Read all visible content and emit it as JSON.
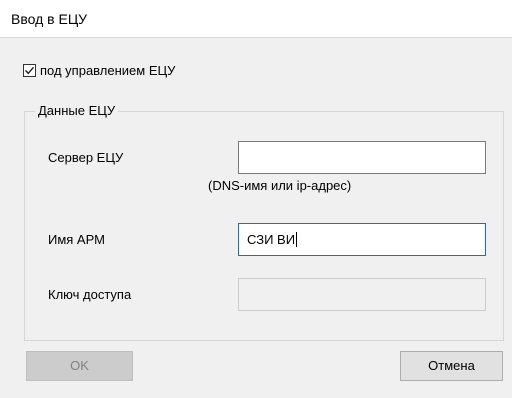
{
  "window": {
    "title": "Ввод в ЕЦУ"
  },
  "managed": {
    "label": "под управлением ЕЦУ",
    "checked": true
  },
  "group": {
    "title": "Данные ЕЦУ",
    "server_label": "Сервер ЕЦУ",
    "server_value": "",
    "server_hint": "(DNS-имя или ip-адрес)",
    "arm_label": "Имя АРМ",
    "arm_value": "СЗИ ВИ",
    "key_label": "Ключ доступа",
    "key_value": ""
  },
  "buttons": {
    "ok": "OK",
    "cancel": "Отмена"
  }
}
